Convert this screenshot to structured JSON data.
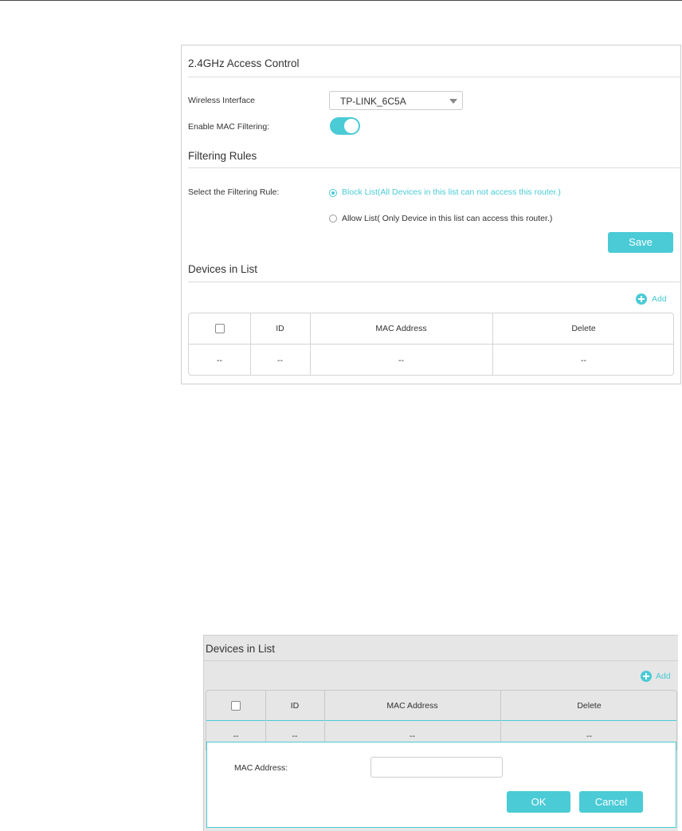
{
  "access_control": {
    "title": "2.4GHz Access Control",
    "wireless_interface_label": "Wireless Interface",
    "wireless_interface_value": "TP-LINK_6C5A",
    "mac_filtering_label": "Enable MAC Filtering:",
    "mac_filtering_enabled": true
  },
  "filtering_rules": {
    "title": "Filtering Rules",
    "rule_label": "Select the Filtering Rule:",
    "block_option": "Block List(All Devices in this list can not access this router.)",
    "allow_option": "Allow List( Only Device in this list can access this router.)",
    "selected": "block",
    "save_label": "Save"
  },
  "devices": {
    "title": "Devices in List",
    "add_label": "Add",
    "columns": [
      "ID",
      "MAC Address",
      "Delete"
    ],
    "row": [
      "--",
      "--",
      "--",
      "--"
    ]
  },
  "edit_panel": {
    "title": "Devices in List",
    "add_label": "Add",
    "columns": [
      "ID",
      "MAC Address",
      "Delete"
    ],
    "row": [
      "--",
      "--",
      "--",
      "--"
    ],
    "mac_label": "MAC Address:",
    "mac_value": "",
    "ok_label": "OK",
    "cancel_label": "Cancel"
  },
  "colors": {
    "accent": "#4acbd6",
    "panel_gray": "#e6e6e6"
  }
}
